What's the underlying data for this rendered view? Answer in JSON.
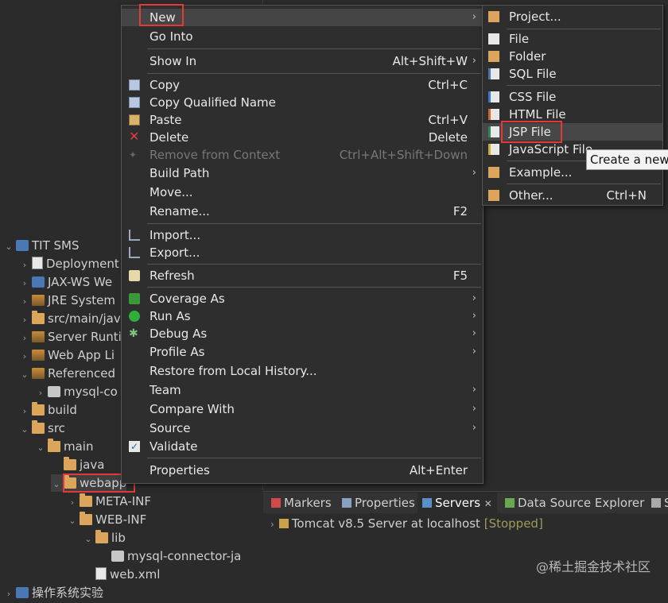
{
  "explorer": {
    "items": [
      {
        "label": "TIT SMS",
        "icon": "project-icon",
        "chev": "⌄"
      },
      {
        "label": "Deployment",
        "icon": "deployment-icon",
        "chev": "›"
      },
      {
        "label": "JAX-WS We",
        "icon": "webservice-icon",
        "chev": "›"
      },
      {
        "label": "JRE System",
        "icon": "library-icon",
        "chev": "›"
      },
      {
        "label": "src/main/jav",
        "icon": "source-folder-icon",
        "chev": "›"
      },
      {
        "label": "Server Runti",
        "icon": "library-icon",
        "chev": "›"
      },
      {
        "label": "Web App Li",
        "icon": "library-icon",
        "chev": "›"
      },
      {
        "label": "Referenced",
        "icon": "library-icon",
        "chev": "⌄"
      },
      {
        "label": "mysql-co",
        "icon": "jar-icon",
        "chev": "›"
      },
      {
        "label": "build",
        "icon": "folder-icon",
        "chev": "›"
      },
      {
        "label": "src",
        "icon": "folder-icon",
        "chev": "⌄"
      },
      {
        "label": "main",
        "icon": "folder-icon",
        "chev": "⌄"
      },
      {
        "label": "java",
        "icon": "folder-icon",
        "chev": ""
      },
      {
        "label": "webapp",
        "icon": "folder-icon",
        "chev": "⌄"
      },
      {
        "label": "META-INF",
        "icon": "folder-icon",
        "chev": "›"
      },
      {
        "label": "WEB-INF",
        "icon": "folder-icon",
        "chev": "⌄"
      },
      {
        "label": "lib",
        "icon": "folder-icon",
        "chev": "⌄"
      },
      {
        "label": "mysql-connector-ja",
        "icon": "jar-icon",
        "chev": ""
      },
      {
        "label": "web.xml",
        "icon": "xml-file-icon",
        "chev": ""
      },
      {
        "label": "操作系统实验",
        "icon": "project-icon",
        "chev": "›"
      }
    ]
  },
  "context_menu": {
    "items": [
      {
        "label": "New",
        "shortcut": "",
        "submenu": true,
        "icon": ""
      },
      {
        "label": "Go Into",
        "shortcut": "",
        "submenu": false,
        "icon": ""
      },
      {
        "label": "Show In",
        "shortcut": "Alt+Shift+W",
        "submenu": true,
        "icon": ""
      },
      {
        "label": "Copy",
        "shortcut": "Ctrl+C",
        "submenu": false,
        "icon": "copy-icon"
      },
      {
        "label": "Copy Qualified Name",
        "shortcut": "",
        "submenu": false,
        "icon": "copy-qualified-icon"
      },
      {
        "label": "Paste",
        "shortcut": "Ctrl+V",
        "submenu": false,
        "icon": "paste-icon"
      },
      {
        "label": "Delete",
        "shortcut": "Delete",
        "submenu": false,
        "icon": "delete-icon"
      },
      {
        "label": "Remove from Context",
        "shortcut": "Ctrl+Alt+Shift+Down",
        "submenu": false,
        "icon": "remove-context-icon",
        "disabled": true
      },
      {
        "label": "Build Path",
        "shortcut": "",
        "submenu": true,
        "icon": ""
      },
      {
        "label": "Move...",
        "shortcut": "",
        "submenu": false,
        "icon": ""
      },
      {
        "label": "Rename...",
        "shortcut": "F2",
        "submenu": false,
        "icon": ""
      },
      {
        "label": "Import...",
        "shortcut": "",
        "submenu": false,
        "icon": "import-icon"
      },
      {
        "label": "Export...",
        "shortcut": "",
        "submenu": false,
        "icon": "export-icon"
      },
      {
        "label": "Refresh",
        "shortcut": "F5",
        "submenu": false,
        "icon": "refresh-icon"
      },
      {
        "label": "Coverage As",
        "shortcut": "",
        "submenu": true,
        "icon": "coverage-icon"
      },
      {
        "label": "Run As",
        "shortcut": "",
        "submenu": true,
        "icon": "run-icon"
      },
      {
        "label": "Debug As",
        "shortcut": "",
        "submenu": true,
        "icon": "debug-icon"
      },
      {
        "label": "Profile As",
        "shortcut": "",
        "submenu": true,
        "icon": ""
      },
      {
        "label": "Restore from Local History...",
        "shortcut": "",
        "submenu": false,
        "icon": ""
      },
      {
        "label": "Team",
        "shortcut": "",
        "submenu": true,
        "icon": ""
      },
      {
        "label": "Compare With",
        "shortcut": "",
        "submenu": true,
        "icon": ""
      },
      {
        "label": "Source",
        "shortcut": "",
        "submenu": true,
        "icon": ""
      },
      {
        "label": "Validate",
        "shortcut": "",
        "submenu": false,
        "icon": "validate-check-icon"
      },
      {
        "label": "Properties",
        "shortcut": "Alt+Enter",
        "submenu": false,
        "icon": ""
      }
    ]
  },
  "submenu": {
    "items": [
      {
        "label": "Project...",
        "shortcut": "",
        "icon": "new-project-icon"
      },
      {
        "label": "File",
        "shortcut": "",
        "icon": "new-file-icon"
      },
      {
        "label": "Folder",
        "shortcut": "",
        "icon": "new-folder-icon"
      },
      {
        "label": "SQL File",
        "shortcut": "",
        "icon": "sql-file-icon"
      },
      {
        "label": "CSS File",
        "shortcut": "",
        "icon": "css-file-icon"
      },
      {
        "label": "HTML File",
        "shortcut": "",
        "icon": "html-file-icon"
      },
      {
        "label": "JSP File",
        "shortcut": "",
        "icon": "jsp-file-icon"
      },
      {
        "label": "JavaScript File",
        "shortcut": "",
        "icon": "javascript-file-icon"
      },
      {
        "label": "Example...",
        "shortcut": "",
        "icon": "example-icon"
      },
      {
        "label": "Other...",
        "shortcut": "Ctrl+N",
        "icon": "other-wizard-icon"
      }
    ]
  },
  "tooltip": "Create a new",
  "bottom": {
    "tabs": [
      {
        "label": "Markers",
        "icon": "markers-icon"
      },
      {
        "label": "Properties",
        "icon": "properties-icon"
      },
      {
        "label": "Servers",
        "icon": "servers-icon",
        "close": "✕"
      },
      {
        "label": "Data Source Explorer",
        "icon": "data-source-icon"
      },
      {
        "label": "S",
        "icon": "snippets-icon"
      }
    ],
    "server": {
      "name": "Tomcat v8.5 Server at localhost",
      "status": "[Stopped]",
      "chev": "›"
    }
  },
  "watermark": "@稀土掘金技术社区",
  "colors": {
    "background": "#2b2b2b",
    "menu": "#2e2e2e",
    "highlight_box": "#e03a3a",
    "selected": "#454545"
  }
}
